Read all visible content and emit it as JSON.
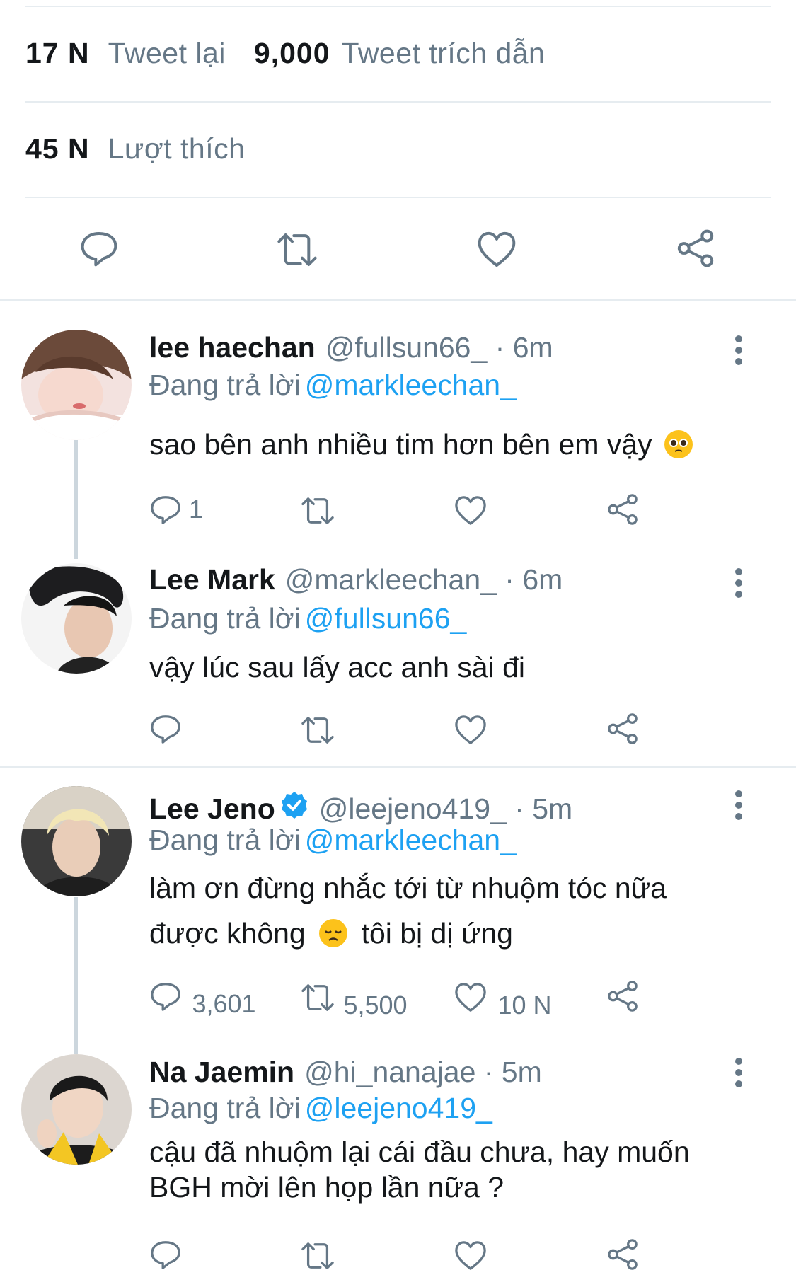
{
  "stats": {
    "retweets_count": "17 N",
    "retweets_label": "Tweet lại",
    "quotes_count": "9,000",
    "quotes_label": "Tweet trích dẫn",
    "likes_count": "45 N",
    "likes_label": "Lượt thích"
  },
  "reply_prefix": "Đang trả lời",
  "tweets": [
    {
      "name": "lee haechan",
      "handle": "@fullsun66_ · 6m",
      "reply_to": "@markleechan_",
      "text_lines": [
        "sao bên anh nhiều tim hơn bên em vậy"
      ],
      "emoji": "pleading-face",
      "reply_count": "1",
      "retweet_count": "",
      "like_count": ""
    },
    {
      "name": "Lee Mark",
      "handle": "@markleechan_ · 6m",
      "reply_to": "@fullsun66_",
      "text_lines": [
        "vậy lúc sau lấy acc anh sài đi"
      ],
      "reply_count": "",
      "retweet_count": "",
      "like_count": ""
    },
    {
      "name": "Lee Jeno",
      "verified": true,
      "handle": "@leejeno419_ · 5m",
      "reply_to": "@markleechan_",
      "text_lines": [
        "làm ơn đừng nhắc tới từ nhuộm tóc nữa",
        "được không",
        "tôi bị dị ứng"
      ],
      "emoji": "disappointed-face",
      "reply_count": "3,601",
      "retweet_count": "5,500",
      "like_count": "10 N"
    },
    {
      "name": "Na Jaemin",
      "handle": "@hi_nanajae · 5m",
      "reply_to": "@leejeno419_",
      "text_lines": [
        "cậu đã nhuộm lại cái đầu chưa, hay muốn",
        "BGH mời lên họp lần nữa ?"
      ],
      "reply_count": "",
      "retweet_count": "",
      "like_count": ""
    }
  ],
  "colors": {
    "text": "#14171a",
    "secondary": "#657786",
    "link": "#1da1f2",
    "divider": "#e6ecf0",
    "thread_line": "#ccd6dd"
  },
  "icons": [
    "reply-icon",
    "retweet-icon",
    "like-icon",
    "share-icon",
    "more-icon",
    "verified-badge-icon"
  ]
}
